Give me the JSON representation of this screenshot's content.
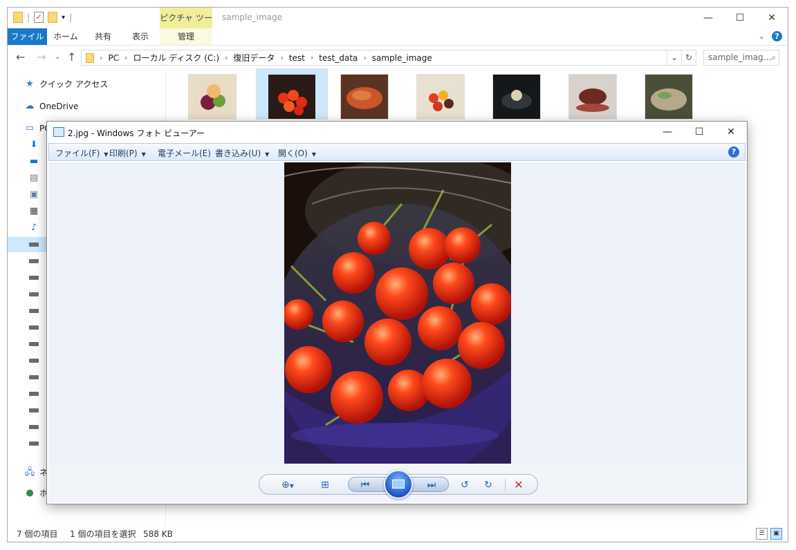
{
  "explorer": {
    "title": "sample_image",
    "context_tab_group": "ピクチャ ツール",
    "ribbon_tabs": [
      "ファイル",
      "ホーム",
      "共有",
      "表示",
      "管理"
    ],
    "breadcrumbs": [
      "PC",
      "ローカル ディスク (C:)",
      "復旧データ",
      "test",
      "test_data",
      "sample_image"
    ],
    "search_placeholder": "sample_imag...",
    "nav": {
      "quick_access": "クイック アクセス",
      "onedrive": "OneDrive",
      "pc": "PC",
      "network": "ネ",
      "homegroup": "ホ"
    },
    "status": {
      "item_count": "7 個の項目",
      "selection": "1 個の項目を選択",
      "size": "588 KB"
    }
  },
  "viewer": {
    "title": "2.jpg - Windows フォト ビューアー",
    "menus": [
      "ファイル(F)",
      "印刷(P)",
      "電子メール(E)",
      "書き込み(U)",
      "開く(O)"
    ],
    "help": "?",
    "toolbar_icons": [
      "zoom-icon",
      "actual-size-icon",
      "previous-icon",
      "slideshow-icon",
      "next-icon",
      "rotate-left-icon",
      "rotate-right-icon",
      "delete-icon"
    ]
  }
}
